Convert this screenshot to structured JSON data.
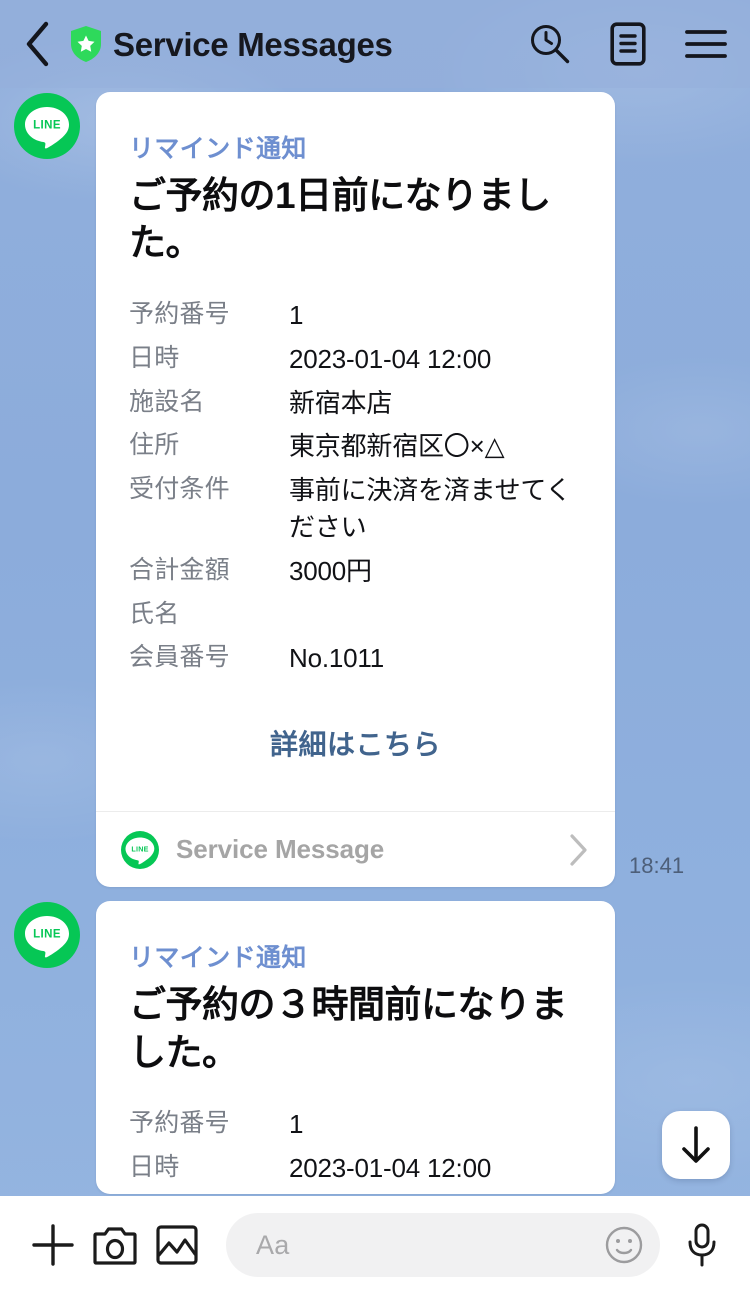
{
  "header": {
    "title": "Service Messages",
    "back_icon": "chevron-left-icon",
    "verified_icon": "shield-star-icon",
    "search_icon": "search-clock-icon",
    "notes_icon": "note-list-icon",
    "menu_icon": "hamburger-menu-icon"
  },
  "messages": [
    {
      "avatar_label": "LINE",
      "kicker": "リマインド通知",
      "headline": "ご予約の1日前になりました。",
      "details": [
        {
          "label": "予約番号",
          "value": "1"
        },
        {
          "label": "日時",
          "value": "2023-01-04 12:00"
        },
        {
          "label": "施設名",
          "value": "新宿本店"
        },
        {
          "label": "住所",
          "value": "東京都新宿区〇×△"
        },
        {
          "label": "受付条件",
          "value": "事前に決済を済ませてください"
        },
        {
          "label": "合計金額",
          "value": "3000円"
        },
        {
          "label": "氏名",
          "value": ""
        },
        {
          "label": "会員番号",
          "value": "No.1011"
        }
      ],
      "cta": "詳細はこちら",
      "footer_label": "Service Message",
      "footer_chevron": "chevron-right-icon",
      "timestamp": "18:41"
    },
    {
      "avatar_label": "LINE",
      "kicker": "リマインド通知",
      "headline": "ご予約の３時間前になりました。",
      "details": [
        {
          "label": "予約番号",
          "value": "1"
        },
        {
          "label": "日時",
          "value": "2023-01-04 12:00"
        }
      ]
    }
  ],
  "scroll_button": {
    "icon": "arrow-down-icon"
  },
  "toolbar": {
    "plus_icon": "plus-icon",
    "camera_icon": "camera-icon",
    "gallery_icon": "image-icon",
    "input_placeholder": "Aa",
    "emoji_icon": "smiley-icon",
    "mic_icon": "microphone-icon"
  },
  "colors": {
    "brand_green": "#06C755",
    "wallpaper_blue": "#8FAEDC",
    "kicker_blue": "#6E8FD0",
    "cta_blue": "#41648D"
  }
}
